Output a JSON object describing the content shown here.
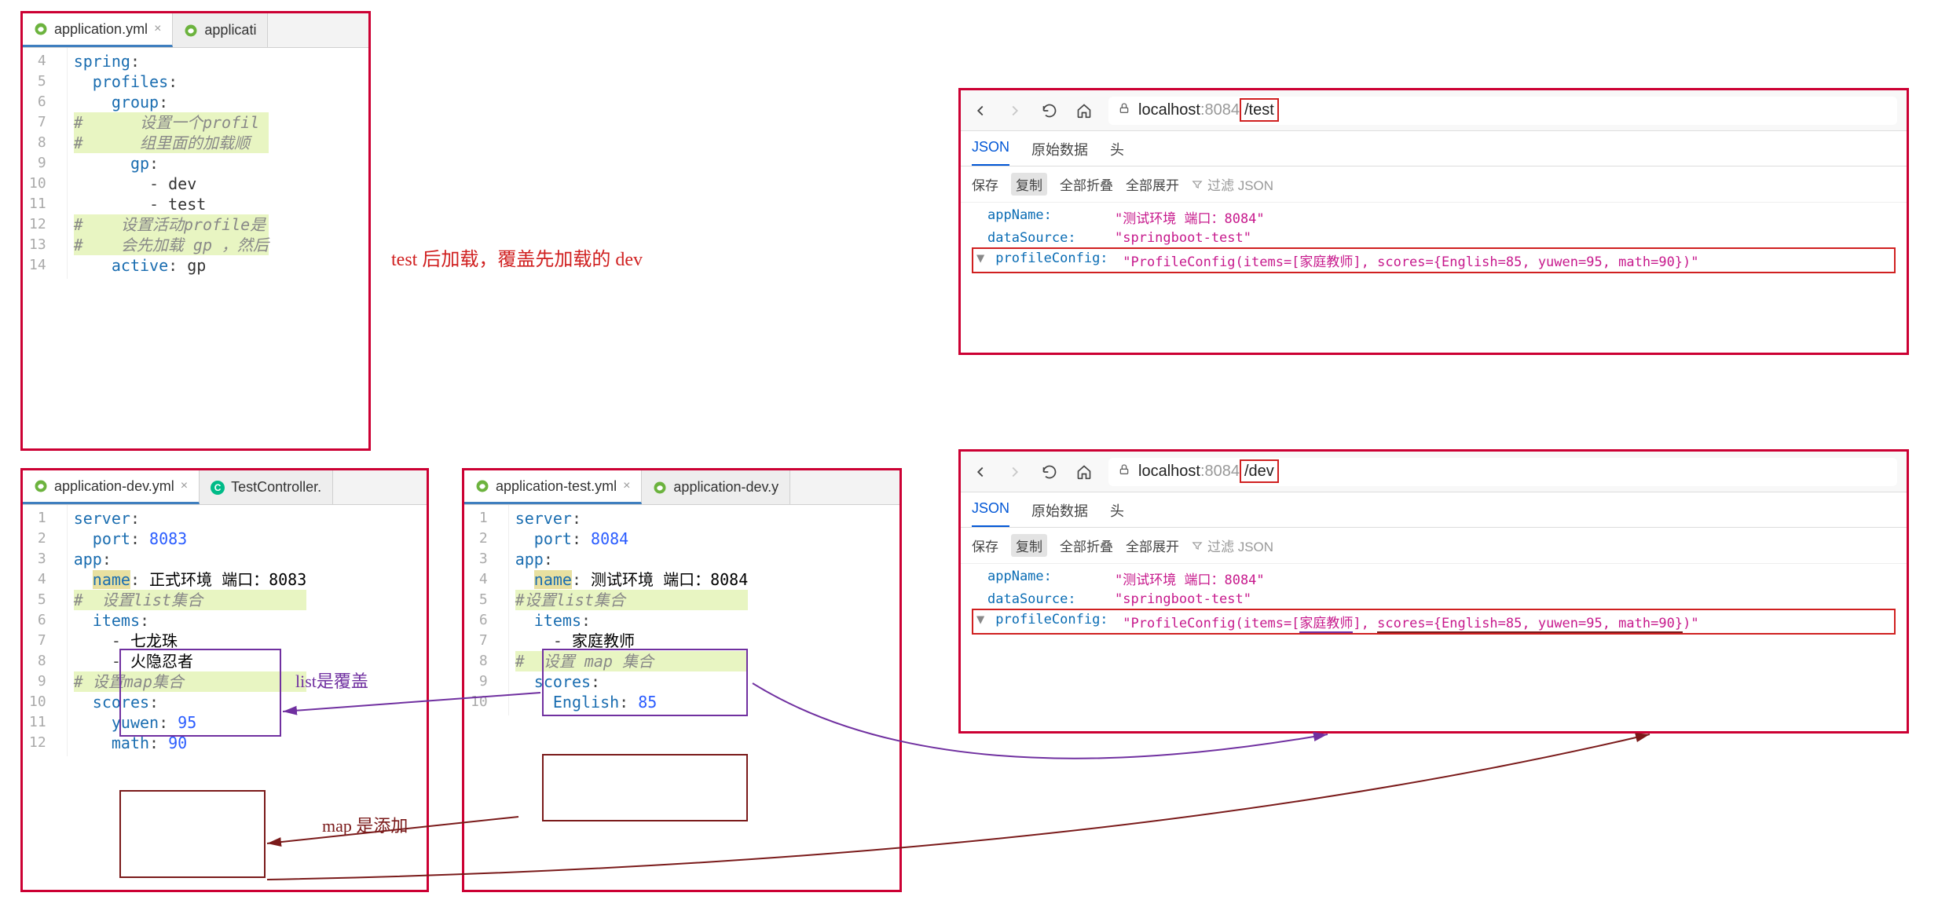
{
  "editors": {
    "yml_main": {
      "tabs": [
        {
          "icon": "spring",
          "label": "application.yml",
          "active": true
        },
        {
          "icon": "spring",
          "label": "applicati",
          "active": false
        }
      ],
      "lines": [
        {
          "n": 4,
          "html": "<span class='tok-key'>spring</span><span class='tok-punc'>:</span>"
        },
        {
          "n": 5,
          "html": "  <span class='tok-key'>profiles</span><span class='tok-punc'>:</span>"
        },
        {
          "n": 6,
          "html": "    <span class='tok-key'>group</span><span class='tok-punc'>:</span>"
        },
        {
          "n": 7,
          "hl": "green",
          "html": "<span class='tok-comm'>#      设置一个profil</span>"
        },
        {
          "n": 8,
          "hl": "green",
          "html": "<span class='tok-comm'>#      组里面的加载顺</span>"
        },
        {
          "n": 9,
          "html": "      <span class='tok-key'>gp</span><span class='tok-punc'>:</span>"
        },
        {
          "n": 10,
          "html": "        <span class='tok-punc'>-</span> <span class='tok-str'>dev</span>"
        },
        {
          "n": 11,
          "html": "        <span class='tok-punc'>-</span> <span class='tok-str'>test</span>"
        },
        {
          "n": 12,
          "hl": "green",
          "html": "<span class='tok-comm'>#    设置活动profile是</span>"
        },
        {
          "n": 13,
          "hl": "green",
          "html": "<span class='tok-comm'>#    会先加载 gp ，然后</span>"
        },
        {
          "n": 14,
          "html": "    <span class='tok-key'>active</span><span class='tok-punc'>:</span> <span class='tok-str'>gp</span>"
        }
      ]
    },
    "yml_dev": {
      "tabs": [
        {
          "icon": "spring",
          "label": "application-dev.yml",
          "active": true
        },
        {
          "icon": "c",
          "label": "TestController.",
          "active": false
        }
      ],
      "lines": [
        {
          "n": 1,
          "html": "<span class='tok-key'>server</span><span class='tok-punc'>:</span>"
        },
        {
          "n": 2,
          "html": "  <span class='tok-key'>port</span><span class='tok-punc'>:</span> <span class='tok-num'>8083</span>"
        },
        {
          "n": 3,
          "html": "<span class='tok-key'>app</span><span class='tok-punc'>:</span>"
        },
        {
          "n": 4,
          "html": "  <span class='hl-yellow'><span class='tok-key'>name</span></span><span class='tok-punc'>:</span> 正式环境 端口：8083"
        },
        {
          "n": 5,
          "hl": "green",
          "html": "<span class='tok-comm'>#  设置list集合</span>"
        },
        {
          "n": 6,
          "html": "  <span class='tok-key'>items</span><span class='tok-punc'>:</span>"
        },
        {
          "n": 7,
          "html": "    <span class='tok-punc'>-</span> 七龙珠"
        },
        {
          "n": 8,
          "html": "    <span class='tok-punc'>-</span> 火隐忍者"
        },
        {
          "n": 9,
          "hl": "green",
          "html": "<span class='tok-comm'># 设置map集合</span>"
        },
        {
          "n": 10,
          "html": "  <span class='tok-key'>scores</span><span class='tok-punc'>:</span>"
        },
        {
          "n": 11,
          "html": "    <span class='tok-key'>yuwen</span><span class='tok-punc'>:</span> <span class='tok-num'>95</span>"
        },
        {
          "n": 12,
          "html": "    <span class='tok-key'>math</span><span class='tok-punc'>:</span> <span class='tok-num'>90</span>"
        }
      ]
    },
    "yml_test": {
      "tabs": [
        {
          "icon": "spring",
          "label": "application-test.yml",
          "active": true
        },
        {
          "icon": "spring",
          "label": "application-dev.y",
          "active": false
        }
      ],
      "lines": [
        {
          "n": 1,
          "html": "<span class='tok-key'>server</span><span class='tok-punc'>:</span>"
        },
        {
          "n": 2,
          "html": "  <span class='tok-key'>port</span><span class='tok-punc'>:</span> <span class='tok-num'>8084</span>"
        },
        {
          "n": 3,
          "html": "<span class='tok-key'>app</span><span class='tok-punc'>:</span>"
        },
        {
          "n": 4,
          "html": "  <span class='hl-yellow'><span class='tok-key'>name</span></span><span class='tok-punc'>:</span> 测试环境 端口：8084"
        },
        {
          "n": 5,
          "hl": "green",
          "html": "<span class='tok-comm'>#设置list集合</span>"
        },
        {
          "n": 6,
          "html": "  <span class='tok-key'>items</span><span class='tok-punc'>:</span>"
        },
        {
          "n": 7,
          "html": "    <span class='tok-punc'>-</span> 家庭教师"
        },
        {
          "n": 8,
          "hl": "green",
          "html": "<span class='tok-comm'>#  设置 map 集合</span>"
        },
        {
          "n": 9,
          "html": "  <span class='tok-key'>scores</span><span class='tok-punc'>:</span>"
        },
        {
          "n": 10,
          "html": "    <span class='tok-key'>English</span><span class='tok-punc'>:</span> <span class='tok-num'>85</span>"
        }
      ]
    }
  },
  "browser1": {
    "url_host": "localhost",
    "url_port": ":8084",
    "url_path": "/test",
    "tabs": {
      "json": "JSON",
      "raw": "原始数据",
      "head": "头"
    },
    "tools": {
      "save": "保存",
      "copy": "复制",
      "collapse": "全部折叠",
      "expand": "全部展开",
      "filter": "过滤 JSON"
    },
    "json": {
      "appName_k": "appName:",
      "appName_v": "\"测试环境 端口：8084\"",
      "dataSource_k": "dataSource:",
      "dataSource_v": "\"springboot-test\"",
      "profileConfig_k": "profileConfig:",
      "profileConfig_v": "\"ProfileConfig(items=[家庭教师], scores={English=85, yuwen=95, math=90})\""
    }
  },
  "browser2": {
    "url_host": "localhost",
    "url_port": ":8084",
    "url_path": "/dev",
    "tabs": {
      "json": "JSON",
      "raw": "原始数据",
      "head": "头"
    },
    "tools": {
      "save": "保存",
      "copy": "复制",
      "collapse": "全部折叠",
      "expand": "全部展开",
      "filter": "过滤 JSON"
    },
    "json": {
      "appName_k": "appName:",
      "appName_v": "\"测试环境 端口：8084\"",
      "dataSource_k": "dataSource:",
      "dataSource_v": "\"springboot-test\"",
      "profileConfig_k": "profileConfig:",
      "profileConfig_v": "\"ProfileConfig(items=[家庭教师], scores={English=85, yuwen=95, math=90})\""
    }
  },
  "annot": {
    "red1": "test 后加载，覆盖先加载的 dev",
    "purple1": "list是覆盖",
    "darkred1": "map 是添加"
  }
}
